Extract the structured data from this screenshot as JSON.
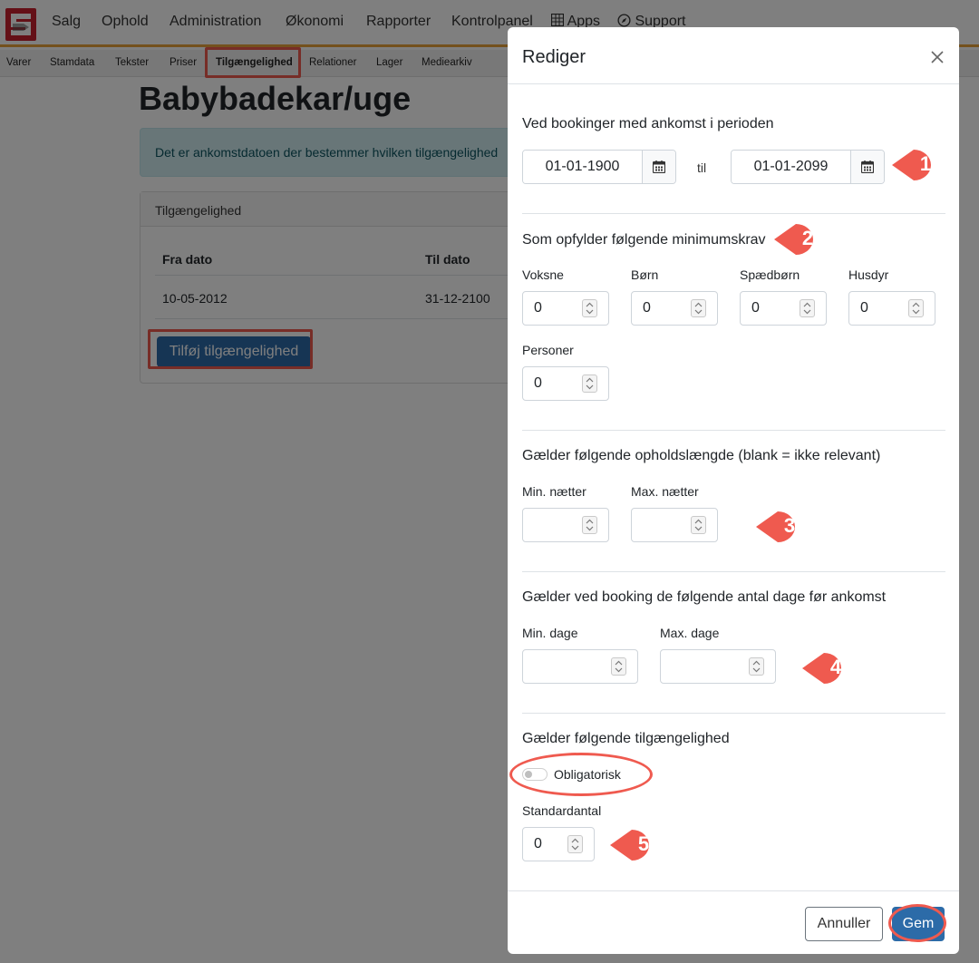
{
  "nav": {
    "items": [
      "Salg",
      "Ophold",
      "Administration",
      "Økonomi",
      "Rapporter",
      "Kontrolpanel",
      "Apps",
      "Support"
    ]
  },
  "subnav": {
    "items": [
      "Varer",
      "Stamdata",
      "Tekster",
      "Priser",
      "Tilgængelighed",
      "Relationer",
      "Lager",
      "Mediearkiv"
    ],
    "active": "Tilgængelighed"
  },
  "page": {
    "title": "Babybadekar/uge",
    "info": "Det er ankomstdatoen der bestemmer hvilken tilgængelighed"
  },
  "availability_card": {
    "header": "Tilgængelighed",
    "columns": [
      "Fra dato",
      "Til dato"
    ],
    "rows": [
      [
        "10-05-2012",
        "31-12-2100"
      ]
    ],
    "add_button": "Tilføj tilgængelighed"
  },
  "modal": {
    "title": "Rediger",
    "period": {
      "heading": "Ved bookinger med ankomst i perioden",
      "from": "01-01-1900",
      "to_label": "til",
      "to": "01-01-2099"
    },
    "requirements": {
      "heading": "Som opfylder følgende minimumskrav",
      "fields": [
        {
          "label": "Voksne",
          "value": "0"
        },
        {
          "label": "Børn",
          "value": "0"
        },
        {
          "label": "Spædbørn",
          "value": "0"
        },
        {
          "label": "Husdyr",
          "value": "0"
        },
        {
          "label": "Personer",
          "value": "0"
        }
      ]
    },
    "stay": {
      "heading": "Gælder følgende opholdslængde (blank = ikke relevant)",
      "min_label": "Min. nætter",
      "max_label": "Max. nætter",
      "min_value": "",
      "max_value": ""
    },
    "days_before": {
      "heading": "Gælder ved booking de følgende antal dage før ankomst",
      "min_label": "Min. dage",
      "max_label": "Max. dage",
      "min_value": "",
      "max_value": ""
    },
    "availability": {
      "heading": "Gælder følgende tilgængelighed",
      "toggle_label": "Obligatorisk",
      "toggle_on": false,
      "default_label": "Standardantal",
      "default_value": "0"
    },
    "cancel": "Annuller",
    "save": "Gem"
  },
  "callouts": [
    "1",
    "2",
    "3",
    "4",
    "5"
  ],
  "colors": {
    "primary": "#2c6ba8",
    "brand_red": "#c8202f",
    "nav_accent": "#e8a33a",
    "annotation": "#ef5a4f",
    "info_bg": "#d1ecf1"
  },
  "icons": [
    "calendar-icon",
    "close-icon",
    "grid-icon",
    "compass-icon",
    "spinner-arrows-icon"
  ]
}
